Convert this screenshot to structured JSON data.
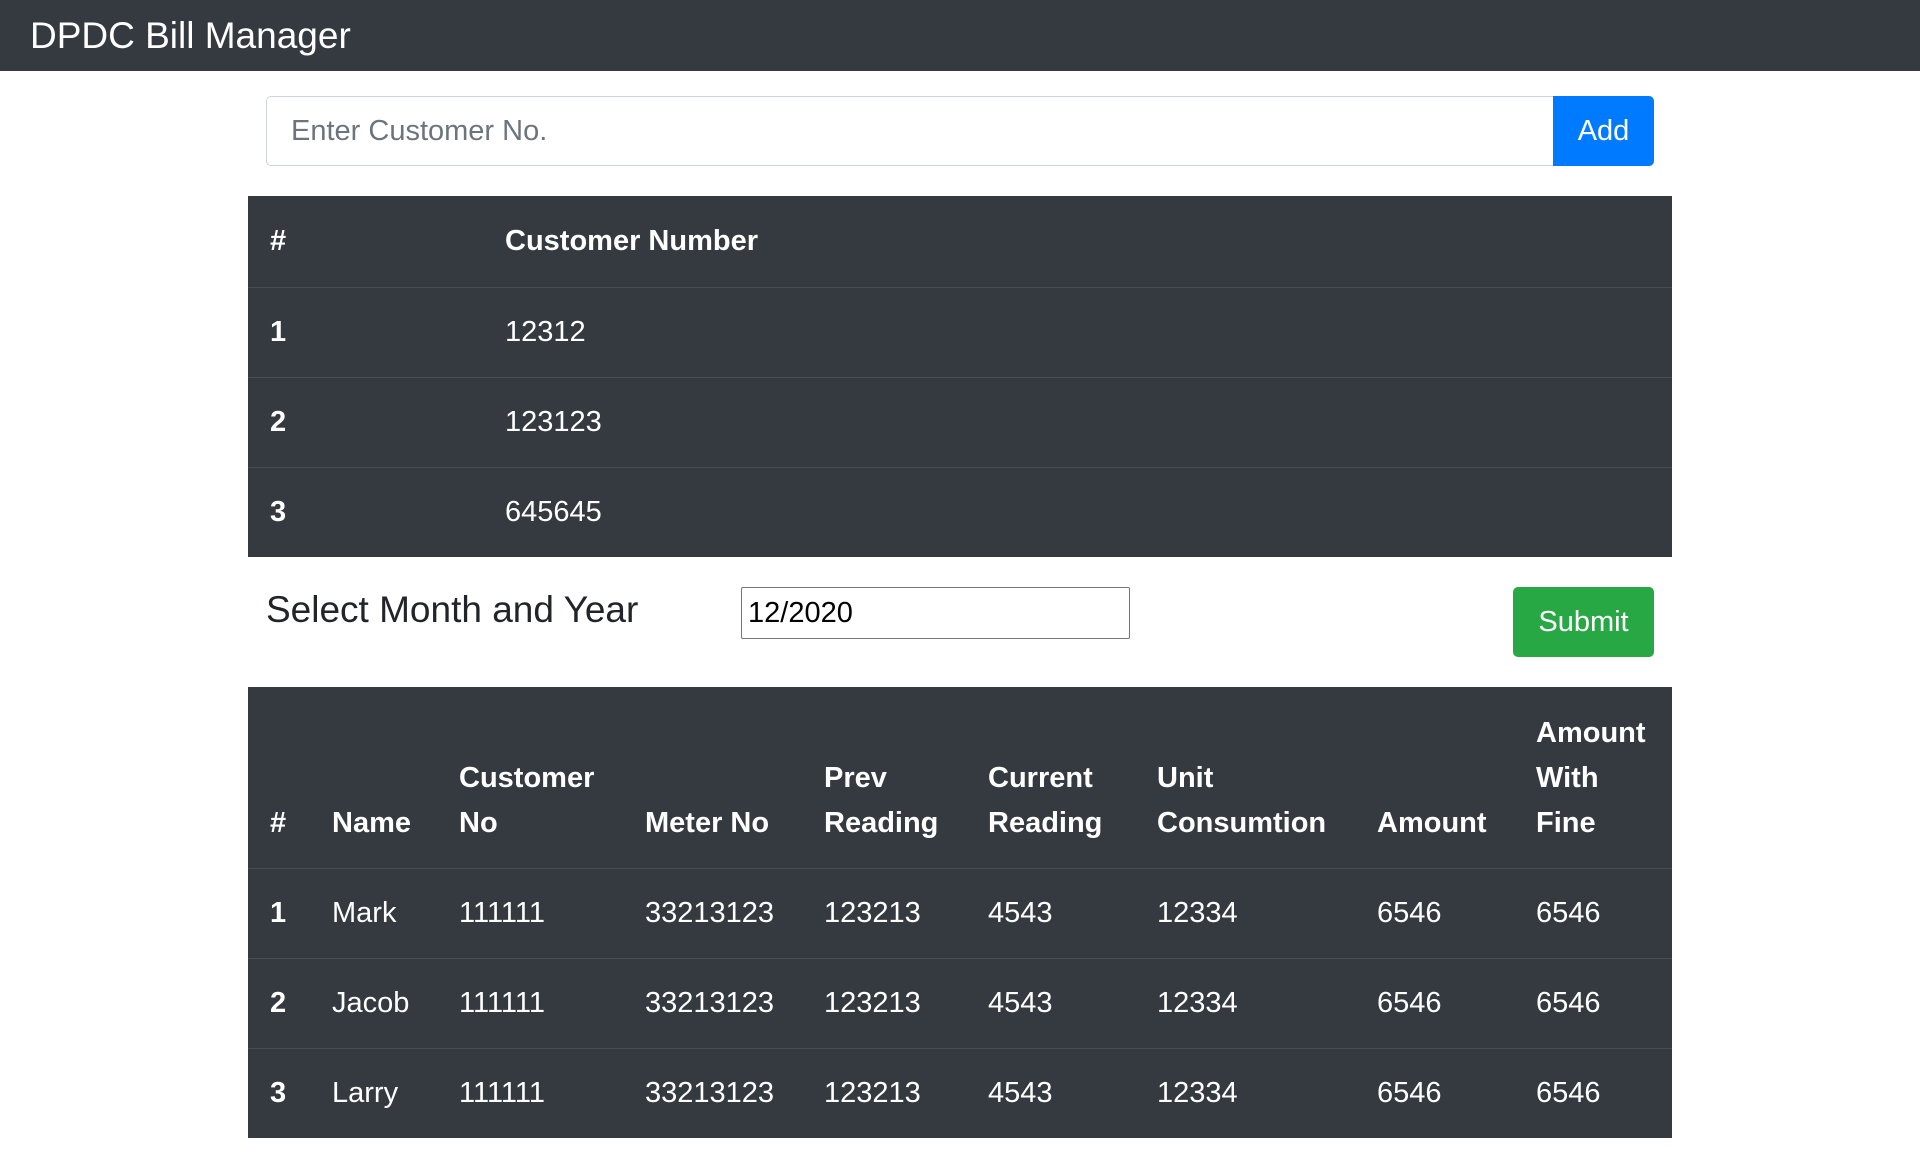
{
  "app": {
    "title": "DPDC Bill Manager"
  },
  "add_form": {
    "placeholder": "Enter Customer No.",
    "value": "",
    "add_label": "Add"
  },
  "customers": {
    "headers": [
      "#",
      "Customer Number"
    ],
    "rows": [
      {
        "index": "1",
        "number": "12312"
      },
      {
        "index": "2",
        "number": "123123"
      },
      {
        "index": "3",
        "number": "645645"
      }
    ]
  },
  "filter": {
    "label": "Select Month and Year",
    "value": "12/2020",
    "submit_label": "Submit"
  },
  "bills": {
    "headers": {
      "index": "#",
      "name": "Name",
      "customer_no_1": "Customer",
      "customer_no_2": "No",
      "meter_no": "Meter No",
      "prev_1": "Prev",
      "prev_2": "Reading",
      "current_1": "Current",
      "current_2": "Reading",
      "unit_1": "Unit",
      "unit_2": "Consumtion",
      "amount": "Amount",
      "fine_1": "Amount",
      "fine_2": "With",
      "fine_3": "Fine"
    },
    "rows": [
      {
        "index": "1",
        "name": "Mark",
        "customer_no": "111111",
        "meter_no": "33213123",
        "prev": "123213",
        "current": "4543",
        "unit": "12334",
        "amount": "6546",
        "fine": "6546"
      },
      {
        "index": "2",
        "name": "Jacob",
        "customer_no": "111111",
        "meter_no": "33213123",
        "prev": "123213",
        "current": "4543",
        "unit": "12334",
        "amount": "6546",
        "fine": "6546"
      },
      {
        "index": "3",
        "name": "Larry",
        "customer_no": "111111",
        "meter_no": "33213123",
        "prev": "123213",
        "current": "4543",
        "unit": "12334",
        "amount": "6546",
        "fine": "6546"
      }
    ]
  },
  "colors": {
    "navbar": "#343a40",
    "primary": "#007bff",
    "success": "#28a745",
    "table_dark": "#343a40"
  }
}
